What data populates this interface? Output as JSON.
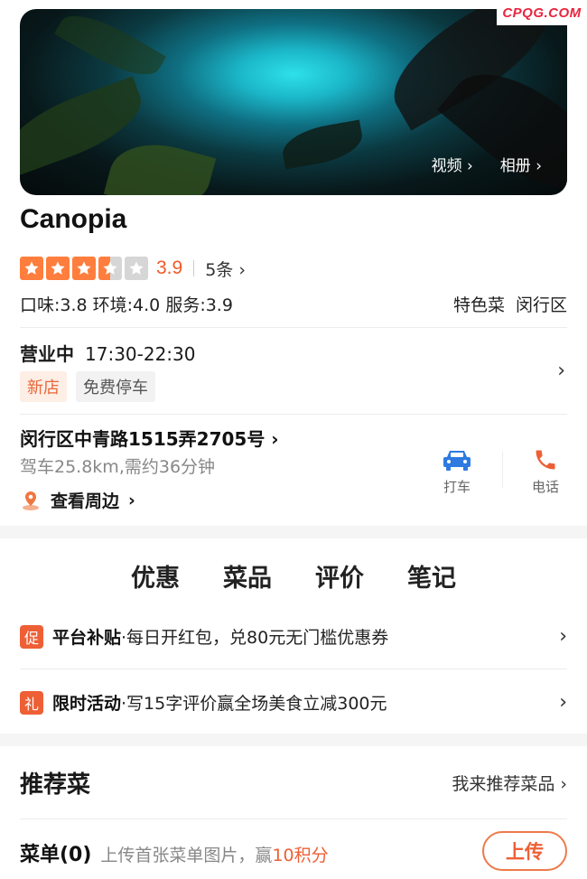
{
  "watermark": "CPQG.COM",
  "hero": {
    "video_label": "视频",
    "album_label": "相册"
  },
  "restaurant": {
    "name": "Canopia",
    "stars": 3.5,
    "score": "3.9",
    "review_count": "5条",
    "subscores": "口味:3.8 环境:4.0 服务:3.9",
    "category": "特色菜",
    "district": "闵行区"
  },
  "hours": {
    "status": "营业中",
    "time": "17:30-22:30"
  },
  "badges": {
    "new": "新店",
    "parking": "免费停车"
  },
  "location": {
    "address": "闵行区中青路1515弄2705号",
    "drive": "驾车25.8km,需约36分钟",
    "nearby": "查看周边"
  },
  "actions": {
    "taxi": "打车",
    "phone": "电话"
  },
  "tabs": [
    "优惠",
    "菜品",
    "评价",
    "笔记"
  ],
  "promos": [
    {
      "badge": "促",
      "title": "平台补贴",
      "desc": "·每日开红包，兑80元无门槛优惠券"
    },
    {
      "badge": "礼",
      "title": "限时活动",
      "desc": "·写15字评价赢全场美食立减300元"
    }
  ],
  "recommend": {
    "title": "推荐菜",
    "link": "我来推荐菜品"
  },
  "menu": {
    "label": "菜单(0)",
    "hint": "上传首张菜单图片，赢",
    "points": "10积分",
    "upload": "上传"
  },
  "colors": {
    "accent": "#ee5f35",
    "star": "#ff7e3d",
    "taxi_blue": "#2d7ae0"
  }
}
